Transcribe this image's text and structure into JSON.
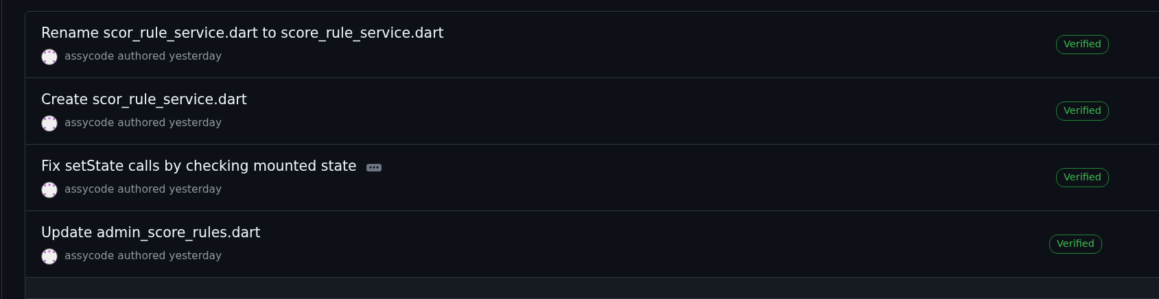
{
  "commits": [
    {
      "title": "Rename scor_rule_service.dart to score_rule_service.dart",
      "author": "assycode",
      "meta": "authored yesterday",
      "badge": "Verified",
      "has_more": false
    },
    {
      "title": "Create scor_rule_service.dart",
      "author": "assycode",
      "meta": "authored yesterday",
      "badge": "Verified",
      "has_more": false
    },
    {
      "title": "Fix setState calls by checking mounted state",
      "author": "assycode",
      "meta": "authored yesterday",
      "badge": "Verified",
      "has_more": true
    },
    {
      "title": "Update admin_score_rules.dart",
      "author": "assycode",
      "meta": "authored yesterday",
      "badge": "Verified",
      "has_more": false
    }
  ]
}
